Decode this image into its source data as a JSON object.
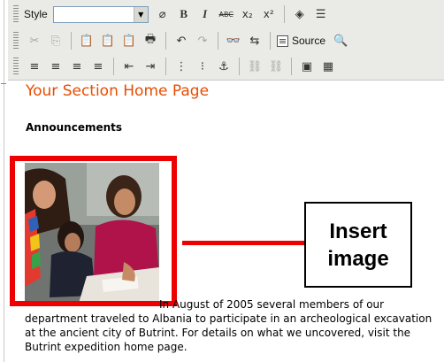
{
  "toolbar": {
    "style_label": "Style",
    "style_value": "",
    "source_label": "Source",
    "row1_buttons": [
      {
        "name": "eraser-icon",
        "glyph": "⌀"
      },
      {
        "name": "bold-icon",
        "glyph": "B"
      },
      {
        "name": "italic-icon",
        "glyph": "I"
      },
      {
        "name": "strikethrough-icon",
        "glyph": "ABC"
      },
      {
        "name": "subscript-icon",
        "glyph": "x₂"
      },
      {
        "name": "superscript-icon",
        "glyph": "x²"
      },
      {
        "name": "special-char-icon",
        "glyph": "◈"
      },
      {
        "name": "horizontal-rule-icon",
        "glyph": "☰"
      }
    ],
    "row2_buttons": [
      {
        "name": "cut-icon",
        "glyph": "✂",
        "dim": true
      },
      {
        "name": "copy-icon",
        "glyph": "⎘",
        "dim": true
      },
      {
        "name": "paste-icon",
        "glyph": "📋"
      },
      {
        "name": "paste-text-icon",
        "glyph": "📋"
      },
      {
        "name": "paste-word-icon",
        "glyph": "📋"
      },
      {
        "name": "print-icon",
        "glyph": "🖶"
      },
      {
        "name": "undo-icon",
        "glyph": "↶"
      },
      {
        "name": "redo-icon",
        "glyph": "↷",
        "dim": true
      },
      {
        "name": "find-icon",
        "glyph": "👓"
      },
      {
        "name": "replace-icon",
        "glyph": "⇆"
      }
    ],
    "row3_buttons": [
      {
        "name": "align-left-icon",
        "glyph": "≡"
      },
      {
        "name": "align-center-icon",
        "glyph": "≡"
      },
      {
        "name": "align-right-icon",
        "glyph": "≡"
      },
      {
        "name": "justify-icon",
        "glyph": "≡"
      },
      {
        "name": "outdent-icon",
        "glyph": "⇤"
      },
      {
        "name": "indent-icon",
        "glyph": "⇥"
      },
      {
        "name": "ordered-list-icon",
        "glyph": "⋮"
      },
      {
        "name": "unordered-list-icon",
        "glyph": "⁝"
      },
      {
        "name": "anchor-icon",
        "glyph": "⚓"
      },
      {
        "name": "link-icon",
        "glyph": "⛓",
        "dim": true
      },
      {
        "name": "unlink-icon",
        "glyph": "⛓",
        "dim": true
      },
      {
        "name": "image-icon",
        "glyph": "▣"
      },
      {
        "name": "table-icon",
        "glyph": "▦"
      }
    ]
  },
  "content": {
    "title": "Your Section Home Page",
    "heading": "Announcements",
    "body": "In August of 2005 several members of our department traveled to Albania to participate in an archeological excavation at the ancient city of Butrint. For details on what we uncovered, visit the Butrint expedition home page."
  },
  "annotation": {
    "callout_text": "Insert\nimage",
    "color": "#ee0000"
  },
  "colors": {
    "title": "#e84c00",
    "toolbar_bg": "#eaeae6"
  }
}
